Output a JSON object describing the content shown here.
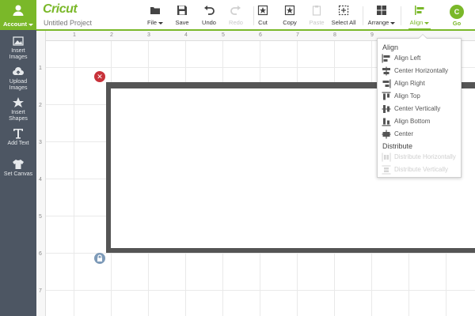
{
  "sidebar": {
    "account": {
      "label": "Account",
      "icon": "user-icon"
    },
    "items": [
      {
        "label": "Insert\nImages",
        "icon": "image-icon"
      },
      {
        "label": "Upload\nImages",
        "icon": "cloud-upload-icon"
      },
      {
        "label": "Insert\nShapes",
        "icon": "shapes-icon"
      },
      {
        "label": "Add Text",
        "icon": "text-icon"
      },
      {
        "label": "Set Canvas",
        "icon": "tshirt-icon"
      }
    ]
  },
  "header": {
    "logo": "Cricut",
    "project_name": "Untitled Project"
  },
  "toolbar": {
    "file": "File",
    "save": "Save",
    "undo": "Undo",
    "redo": "Redo",
    "cut": "Cut",
    "copy": "Copy",
    "paste": "Paste",
    "select_all": "Select All",
    "arrange": "Arrange",
    "align": "Align",
    "go_letter": "C",
    "go": "Go"
  },
  "ruler": {
    "top": [
      "1",
      "2",
      "3",
      "4",
      "5",
      "6",
      "7",
      "8",
      "9"
    ],
    "left": [
      "1",
      "2",
      "3",
      "4",
      "5",
      "6",
      "7"
    ]
  },
  "align_menu": {
    "align_heading": "Align",
    "align_items": [
      {
        "label": "Align Left",
        "icon": "align-left-icon",
        "enabled": true
      },
      {
        "label": "Center Horizontally",
        "icon": "center-horizontal-icon",
        "enabled": true
      },
      {
        "label": "Align Right",
        "icon": "align-right-icon",
        "enabled": true
      },
      {
        "label": "Align Top",
        "icon": "align-top-icon",
        "enabled": true
      },
      {
        "label": "Center Vertically",
        "icon": "center-vertical-icon",
        "enabled": true
      },
      {
        "label": "Align Bottom",
        "icon": "align-bottom-icon",
        "enabled": true
      },
      {
        "label": "Center",
        "icon": "center-icon",
        "enabled": true
      }
    ],
    "distribute_heading": "Distribute",
    "distribute_items": [
      {
        "label": "Distribute Horizontally",
        "icon": "distribute-horizontal-icon",
        "enabled": false
      },
      {
        "label": "Distribute Vertically",
        "icon": "distribute-vertical-icon",
        "enabled": false
      }
    ]
  },
  "colors": {
    "brand_green": "#7ab829",
    "sidebar_bg": "#4d5663",
    "delete_red": "#c8323a"
  }
}
